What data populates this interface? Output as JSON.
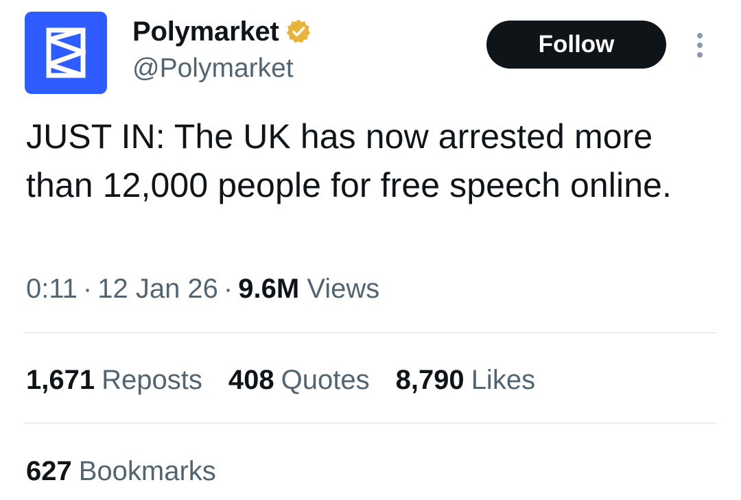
{
  "author": {
    "display_name": "Polymarket",
    "handle": "@Polymarket",
    "avatar_icon": "polymarket-logo",
    "avatar_color": "#2e5cff",
    "verified_badge_color": "#e8b33a"
  },
  "actions": {
    "follow_label": "Follow",
    "more_icon": "vertical-ellipsis-icon"
  },
  "tweet": {
    "text": "JUST IN: The UK has now arrested more than 12,000 people for free speech online."
  },
  "meta": {
    "time": "0:11",
    "date": "12 Jan 26",
    "views_count": "9.6M",
    "views_label": "Views"
  },
  "stats": {
    "reposts": {
      "count": "1,671",
      "label": "Reposts"
    },
    "quotes": {
      "count": "408",
      "label": "Quotes"
    },
    "likes": {
      "count": "8,790",
      "label": "Likes"
    },
    "bookmarks": {
      "count": "627",
      "label": "Bookmarks"
    }
  }
}
